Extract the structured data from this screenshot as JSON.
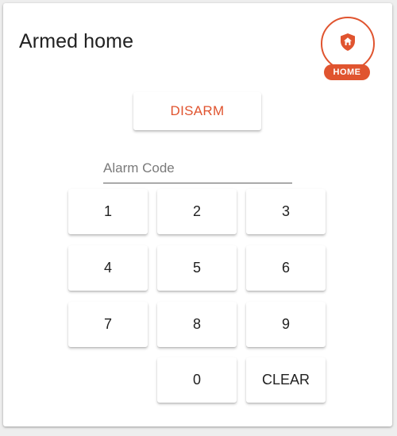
{
  "card": {
    "title": "Armed home"
  },
  "status_badge": {
    "label": "HOME",
    "icon": "shield-home-icon",
    "color": "#e0542f"
  },
  "actions": {
    "disarm_label": "DISARM"
  },
  "alarm_code": {
    "placeholder": "Alarm Code",
    "value": ""
  },
  "keypad": {
    "k1": "1",
    "k2": "2",
    "k3": "3",
    "k4": "4",
    "k5": "5",
    "k6": "6",
    "k7": "7",
    "k8": "8",
    "k9": "9",
    "k0": "0",
    "clear": "CLEAR"
  }
}
